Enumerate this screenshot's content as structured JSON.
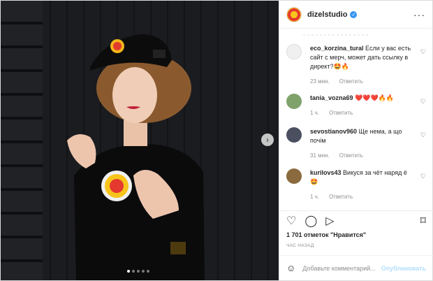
{
  "header": {
    "username": "dizelstudio",
    "verified_icon": "verified-icon",
    "more": "···"
  },
  "carousel": {
    "next": "›",
    "dots": 5,
    "active_dot": 0
  },
  "comments": [
    {
      "username": "eco_korzina_tural",
      "text": "Если у вас есть сайт с мерч, может дать ссылку в директ?🤩🔥",
      "time": "23 мин.",
      "reply": "Ответить"
    },
    {
      "username": "tania_vozna69",
      "text": "❤️❤️❤️🔥🔥",
      "time": "1 ч.",
      "reply": "Ответить"
    },
    {
      "username": "sevostianov960",
      "text": "Ще нема, а що почім",
      "time": "31 мин.",
      "reply": "Ответить"
    },
    {
      "username": "kurilovs43",
      "text": "Викуся за чёт наряд ё🤩",
      "time": "1 ч.",
      "reply": "Ответить"
    }
  ],
  "actions": {
    "like_icon": "♡",
    "comment_icon": "◯",
    "share_icon": "▷",
    "save_icon": "⌑"
  },
  "likes": "1 701 отметок \"Нравится\"",
  "posted": "ЧАС НАЗАД",
  "add_comment": {
    "placeholder": "Добавьте комментарий...",
    "publish": "Опубликовать",
    "emoji_icon": "☺"
  },
  "colors": {
    "link": "#3897f0",
    "publish_disabled": "#b2dffc",
    "meta": "#8e8e8e"
  }
}
